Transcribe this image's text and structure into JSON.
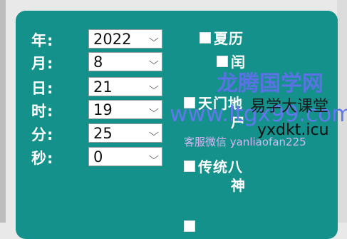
{
  "form": {
    "rows": [
      {
        "label": "年:",
        "value": "2022"
      },
      {
        "label": "月:",
        "value": "8"
      },
      {
        "label": "日:",
        "value": "21"
      },
      {
        "label": "时:",
        "value": "19"
      },
      {
        "label": "分:",
        "value": "25"
      },
      {
        "label": "秒:",
        "value": "0"
      }
    ]
  },
  "options": {
    "summer_time": "夏历",
    "leap": "闰",
    "tianmen_line1": "天门地",
    "tianmen_line2": "户",
    "bashen_line1": "传统八",
    "bashen_line2": "神"
  },
  "watermarks": {
    "brand": "龙腾国学网",
    "site": "www.ltgx99.com",
    "wechat": "客服微信 yanliaofan225",
    "course": "易学大课堂",
    "domain2": "yxdkt.icu"
  },
  "colors": {
    "panel": "#13918a",
    "watermark_blue": "#5b72e6"
  },
  "icons": {
    "dropdown": "chevron-down-icon",
    "checkbox": "checkbox-icon"
  }
}
